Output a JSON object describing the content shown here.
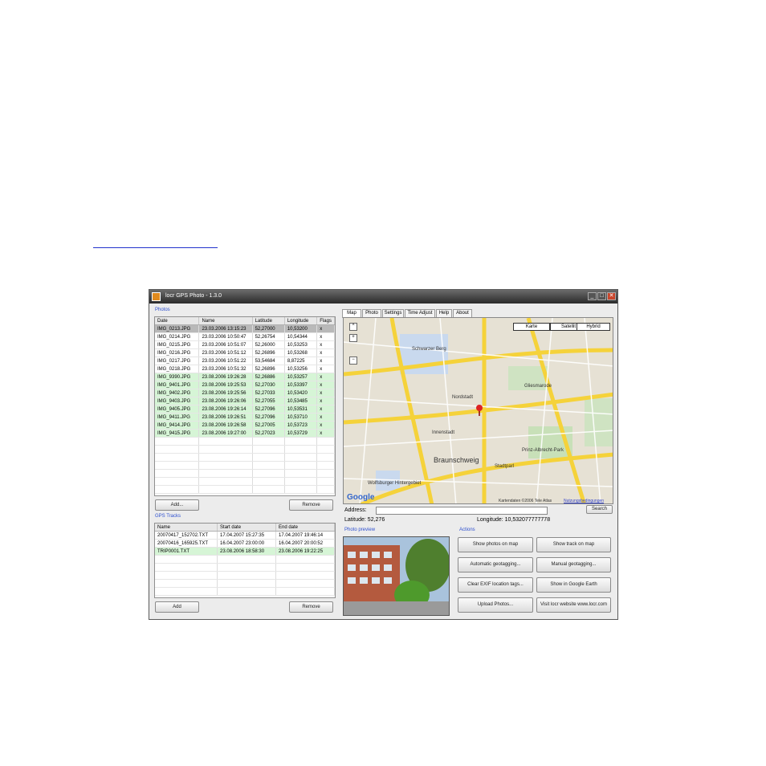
{
  "window": {
    "title": "locr GPS Photo - 1.3.0"
  },
  "photos": {
    "label": "Photos",
    "columns": [
      "Date",
      "Name",
      "Latitude",
      "Longitude",
      "Flags"
    ],
    "rows": [
      [
        "IMG_0213.JPG",
        "23.03.2006 13:15:23",
        "52,27000",
        "10,53200",
        "x"
      ],
      [
        "IMG_0214.JPG",
        "23.03.2006 10:50:47",
        "52,26754",
        "10,54344",
        "x"
      ],
      [
        "IMG_0215.JPG",
        "23.03.2006 10:51:07",
        "52,26000",
        "10,53253",
        "x"
      ],
      [
        "IMG_0216.JPG",
        "23.03.2006 10:51:12",
        "52,26896",
        "10,53268",
        "x"
      ],
      [
        "IMG_0217.JPG",
        "23.03.2006 10:51:22",
        "53,54684",
        "8,87225",
        "x"
      ],
      [
        "IMG_0218.JPG",
        "23.03.2006 10:51:32",
        "52,26896",
        "10,53256",
        "x"
      ],
      [
        "IMG_9390.JPG",
        "23.08.2006 19:26:28",
        "52,26886",
        "10,53257",
        "x"
      ],
      [
        "IMG_9401.JPG",
        "23.08.2006 19:25:53",
        "52,27030",
        "10,53397",
        "x"
      ],
      [
        "IMG_9402.JPG",
        "23.08.2006 19:25:56",
        "52,27033",
        "10,53420",
        "x"
      ],
      [
        "IMG_9403.JPG",
        "23.08.2006 19:26:06",
        "52,27055",
        "10,53485",
        "x"
      ],
      [
        "IMG_9405.JPG",
        "23.08.2006 19:26:14",
        "52,27096",
        "10,53531",
        "x"
      ],
      [
        "IMG_9411.JPG",
        "23.08.2006 19:26:51",
        "52,27096",
        "10,53710",
        "x"
      ],
      [
        "IMG_9414.JPG",
        "23.08.2006 19:26:58",
        "52,27005",
        "10,53723",
        "x"
      ],
      [
        "IMG_9415.JPG",
        "23.08.2006 19:27:00",
        "52,27023",
        "10,53729",
        "x"
      ]
    ],
    "add_label": "Add...",
    "remove_label": "Remove"
  },
  "tracks": {
    "label": "GPS Tracks",
    "columns": [
      "Name",
      "Start date",
      "End date"
    ],
    "rows": [
      [
        "20070417_152702.TXT",
        "17.04.2007 15:27:35",
        "17.04.2007 19:46:14"
      ],
      [
        "20070416_165925.TXT",
        "16.04.2007 23:00:00",
        "16.04.2007 20:00:52"
      ],
      [
        "TRIP0001.TXT",
        "23.08.2006 18:58:30",
        "23.08.2006 19:22:25"
      ]
    ],
    "add_label": "Add",
    "remove_label": "Remove"
  },
  "tabs": [
    "Map",
    "Photo",
    "Settings",
    "Time Adjust",
    "Help",
    "About"
  ],
  "map": {
    "types": [
      "Karte",
      "Satellit",
      "Hybrid"
    ],
    "labels": {
      "city": "Braunschweig",
      "north": "Schwarzer Berg",
      "park": "Prinz-Albrecht-Park",
      "river": "Wolfsburger Hintergebiet",
      "center": "Innenstadt",
      "east": "Gliesmarode",
      "stadt": "Stadtparl",
      "nord": "Nordstadt",
      "copyright": "Kartendaten ©2006 Tele Atlas",
      "terms": "Nutzungsbedingungen",
      "google": "Google"
    }
  },
  "address": {
    "label": "Address:",
    "search_label": "Search",
    "latitude_label": "Latitude: 52,276",
    "longitude_label": "Longitude: 10,532077777778"
  },
  "photo_preview": {
    "label": "Photo preview"
  },
  "actions": {
    "label": "Actions",
    "buttons": [
      "Show photos on map",
      "Show track on map",
      "Automatic geotagging...",
      "Manual geotagging...",
      "Clear EXIF location tags...",
      "Show in Google Earth",
      "Upload Photos...",
      "Visit locr website www.locr.com"
    ]
  }
}
